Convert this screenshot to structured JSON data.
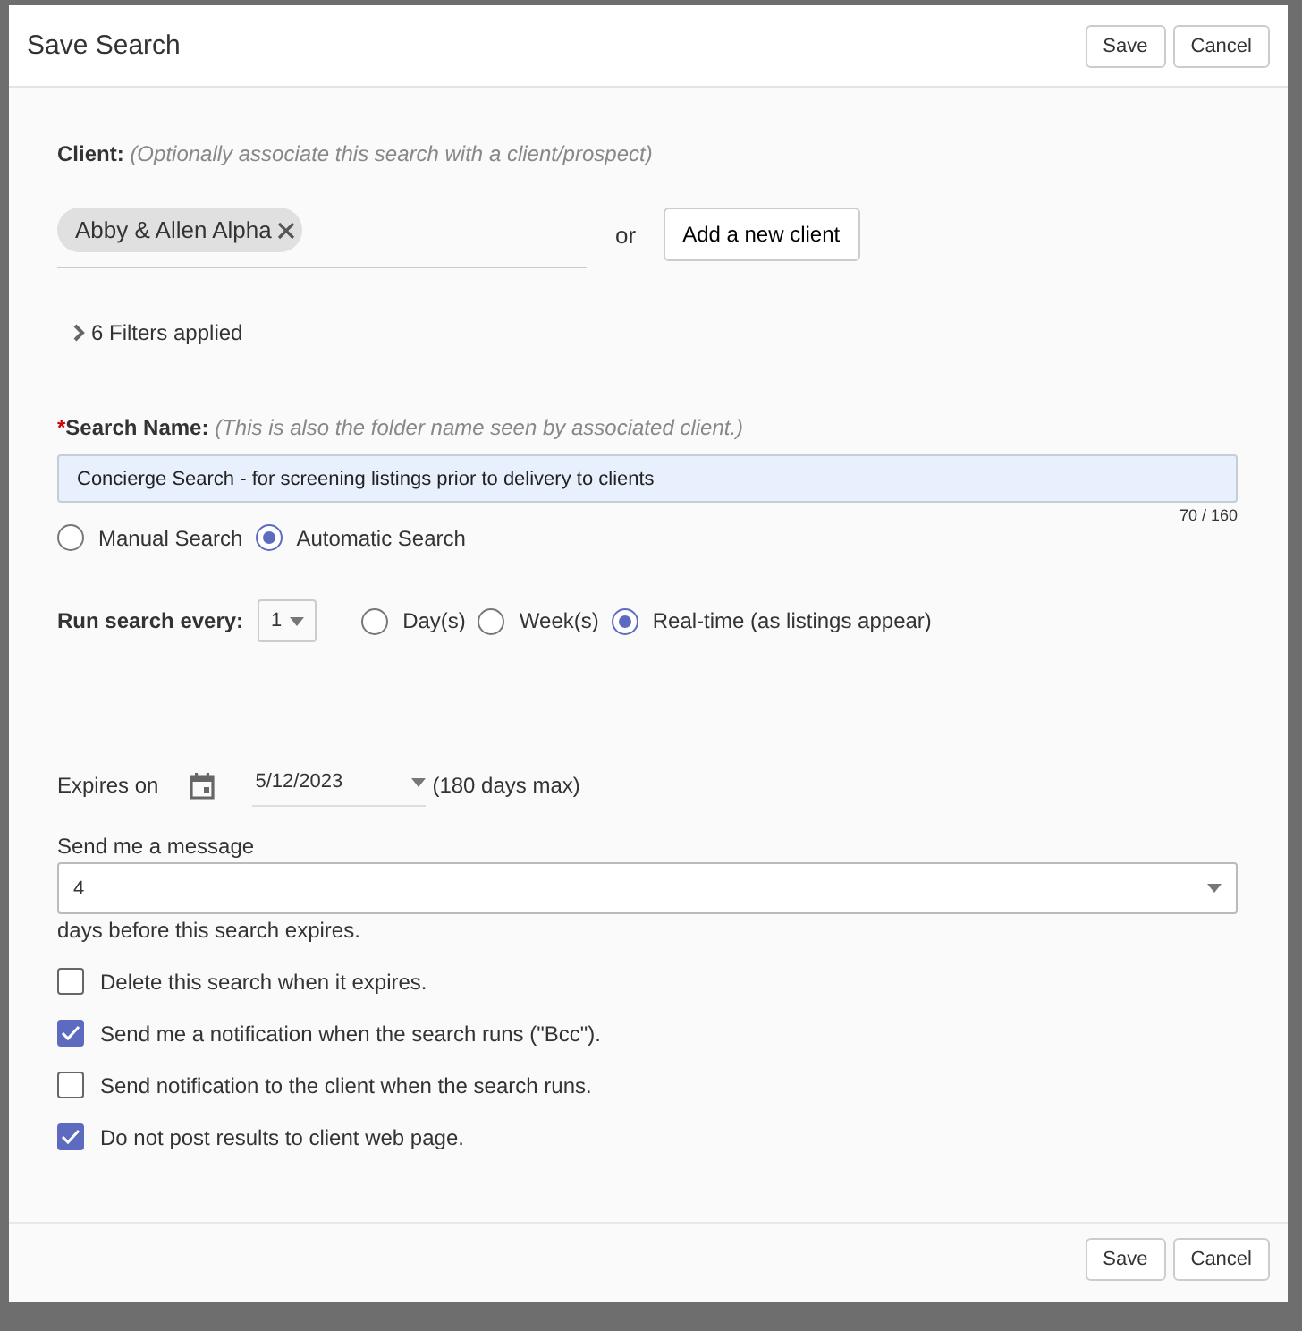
{
  "dialog": {
    "title": "Save Search",
    "header_buttons": [
      "Save",
      "Cancel"
    ],
    "client": {
      "label": "Client:",
      "hint": "(Optionally associate this search with a client/prospect)",
      "chips": [
        "Abby & Allen Alpha"
      ],
      "or": "or",
      "add_button": "Add a new client"
    },
    "filters": {
      "label": "6 Filters applied",
      "expanded": false
    },
    "search_name": {
      "required_mark": "*",
      "label": "Search Name:",
      "hint": "(This is also the folder name seen by associated client.)",
      "value": "Concierge Search - for screening listings prior to delivery to clients",
      "counter": "70 / 160"
    },
    "search_types": [
      {
        "label": "Manual Search",
        "selected": false
      },
      {
        "label": "Automatic Search",
        "selected": true
      }
    ],
    "run_every": {
      "label": "Run search every:",
      "value": "1",
      "units": [
        {
          "label": "Day(s)",
          "selected": false
        },
        {
          "label": "Week(s)",
          "selected": false
        },
        {
          "label": "Real-time (as listings appear)",
          "selected": true
        }
      ]
    },
    "expires": {
      "label": "Expires on",
      "date": "5/12/2023",
      "note": "(180 days max)"
    },
    "message": {
      "label": "Send me a message",
      "value": "4",
      "suffix": "days before this search expires."
    },
    "options": [
      {
        "label": "Delete this search when it expires.",
        "checked": false
      },
      {
        "label": "Send me a notification when the search runs (\"Bcc\").",
        "checked": true
      },
      {
        "label": "Send notification to the client when the search runs.",
        "checked": false
      },
      {
        "label": "Do not post results to client web page.",
        "checked": true
      }
    ],
    "footer_buttons": [
      "Save",
      "Cancel"
    ]
  }
}
